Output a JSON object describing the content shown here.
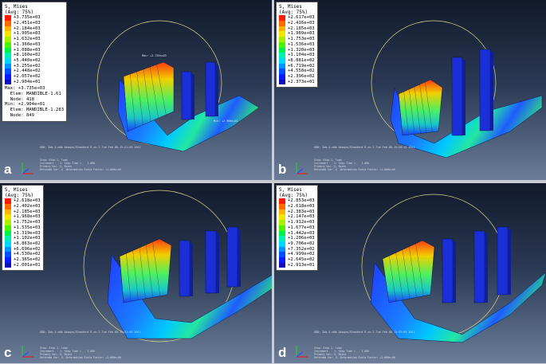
{
  "legend_colors": [
    "#ff1a00",
    "#ff6a00",
    "#ffb300",
    "#f2e600",
    "#a6f000",
    "#4cf200",
    "#00f24a",
    "#00f2b0",
    "#00d6ff",
    "#0095ff",
    "#0050ff",
    "#0a1cff",
    "#1010b8"
  ],
  "panels": [
    {
      "label": "a",
      "legend_title": [
        "S, Mises",
        "(Avg: 75%)"
      ],
      "legend_values": [
        "+3.735e+03",
        "+2.451e+03",
        "+2.184e+03",
        "+1.905e+03",
        "+1.632e+03",
        "+1.360e+03",
        "+1.088e+03",
        "+8.160e+02",
        "+5.440e+02",
        "+3.255e+02",
        "+2.448e+02",
        "+2.057e+02",
        "+2.904e+01"
      ],
      "legend_extra": [
        "Max: +3.735e+03",
        "  Elem: MANDIBLE-1.61",
        "  Node: 418",
        "Min: +2.904e+01",
        "  Elem: MANDIBLE-1.283",
        "  Node: 849"
      ],
      "ann_max": "Max: +3.735e+03",
      "ann_min": "Min: +2.904e+01",
      "status_line": "ODB: Job-1.odb    Abaqus/Standard 6.xx-1    Tue Feb 08 15:21:49 2011",
      "info_lines": [
        "Step: Step-1, load",
        "Increment    1: Step Time =    1.000",
        "Primary Var: S, Mises",
        "Deformed Var: U  Deformation Scale Factor: +1.000e+00"
      ]
    },
    {
      "label": "b",
      "legend_title": [
        "S, Mises",
        "(Avg: 75%)"
      ],
      "legend_values": [
        "+2.617e+03",
        "+2.416e+03",
        "+2.185e+03",
        "+1.969e+03",
        "+1.753e+03",
        "+1.536e+03",
        "+1.320e+03",
        "+1.104e+03",
        "+8.881e+02",
        "+6.719e+02",
        "+4.558e+02",
        "+2.396e+02",
        "+2.373e+01"
      ],
      "legend_extra": [],
      "ann_max": "",
      "ann_min": "",
      "status_line": "ODB: Job-2.odb    Abaqus/Standard 6.xx-1    Tue Feb 08 15:28:12 2011",
      "info_lines": [
        "Step: Step-1, load",
        "Increment    1: Step Time =    1.000",
        "Primary Var: S, Mises",
        "Deformed Var: U  Deformation Scale Factor: +1.000e+00"
      ]
    },
    {
      "label": "c",
      "legend_title": [
        "S, Mises",
        "(Avg: 75%)"
      ],
      "legend_values": [
        "+2.618e+03",
        "+2.402e+03",
        "+2.185e+03",
        "+1.968e+03",
        "+1.752e+03",
        "+1.535e+03",
        "+1.319e+03",
        "+1.102e+03",
        "+8.863e+02",
        "+6.696e+02",
        "+4.530e+02",
        "+2.365e+02",
        "+2.001e+01"
      ],
      "legend_extra": [],
      "ann_max": "",
      "ann_min": "",
      "status_line": "ODB: Job-3.odb    Abaqus/Standard 6.xx-1    Tue Feb 08 15:33:40 2011",
      "info_lines": [
        "Step: Step-1, load",
        "Increment    1: Step Time =    1.000",
        "Primary Var: S, Mises",
        "Deformed Var: U  Deformation Scale Factor: +1.000e+00"
      ]
    },
    {
      "label": "d",
      "legend_title": [
        "S, Mises",
        "(Avg: 75%)"
      ],
      "legend_values": [
        "+2.853e+03",
        "+2.618e+03",
        "+2.383e+03",
        "+2.147e+03",
        "+1.912e+03",
        "+1.677e+03",
        "+1.442e+03",
        "+1.206e+03",
        "+9.706e+02",
        "+7.352e+02",
        "+4.999e+02",
        "+2.645e+02",
        "+2.913e+01"
      ],
      "legend_extra": [],
      "ann_max": "",
      "ann_min": "",
      "status_line": "ODB: Job-4.odb    Abaqus/Standard 6.xx-1    Tue Feb 08 15:39:05 2011",
      "info_lines": [
        "Step: Step-1, load",
        "Increment    1: Step Time =    1.000",
        "Primary Var: S, Mises",
        "Deformed Var: U  Deformation Scale Factor: +1.000e+00"
      ]
    }
  ]
}
